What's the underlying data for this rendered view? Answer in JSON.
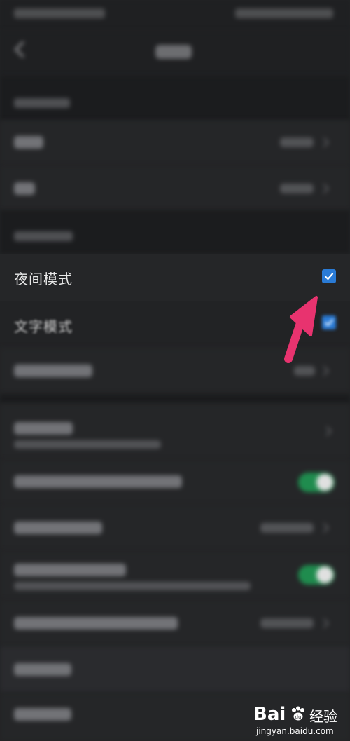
{
  "settings": {
    "night_mode_label": "夜间模式",
    "night_mode_checked": true,
    "text_mode_label": "文字模式",
    "text_mode_checked": true
  },
  "watermark": {
    "brand": "Bai",
    "brand_suffix": "经验",
    "url": "jingyan.baidu.com"
  },
  "colors": {
    "background": "#222325",
    "checkbox": "#2a7bd6",
    "switch_on": "#1f8c4e",
    "arrow": "#e8336f"
  },
  "icons": {
    "back": "back-arrow-icon",
    "checkbox": "check-icon",
    "annotation": "pink-arrow-icon",
    "baidu": "paw-icon"
  }
}
